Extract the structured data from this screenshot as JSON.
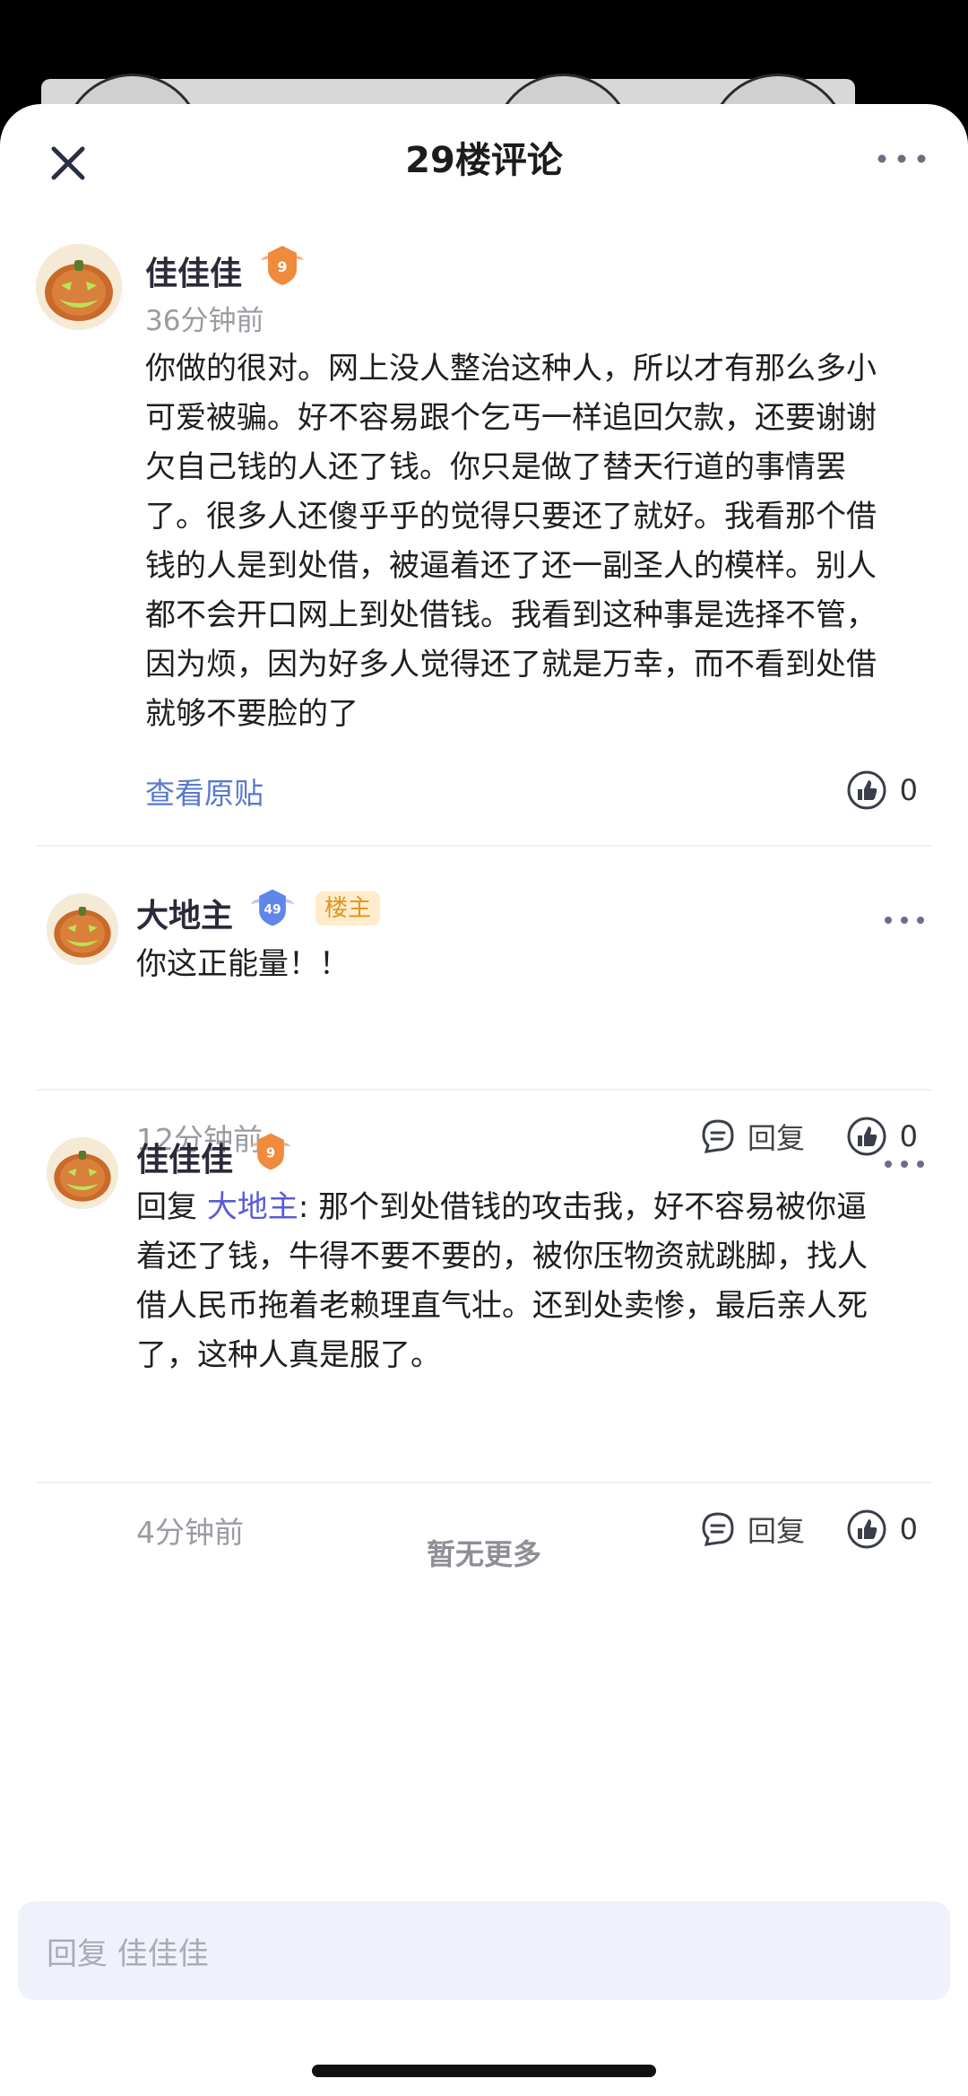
{
  "header": {
    "title": "29楼评论"
  },
  "comments": [
    {
      "author": "佳佳佳",
      "level": "9",
      "time": "36分钟前",
      "text_lines": [
        "你做的很对。网上没人整治这种人，所以才有那么多小",
        "可爱被骗。好不容易跟个乞丐一样追回欠款，还要谢谢",
        "欠自己钱的人还了钱。你只是做了替天行道的事情罢",
        "了。很多人还傻乎乎的觉得只要还了就好。我看那个借",
        "钱的人是到处借，被逼着还了还一副圣人的模样。别人",
        "都不会开口网上到处借钱。我看到这种事是选择不管，",
        "因为烦，因为好多人觉得还了就是万幸，而不看到处借",
        "就够不要脸的了"
      ],
      "view_original": "查看原贴",
      "likes": "0"
    },
    {
      "author": "大地主",
      "level": "49",
      "tag": "楼主",
      "text": "你这正能量！！",
      "time": "12分钟前",
      "reply_label": "回复",
      "likes": "0"
    },
    {
      "author": "佳佳佳",
      "level": "9",
      "reply_prefix": "回复",
      "mention": "大地主",
      "colon": ":",
      "text_line1": "那个到处借钱的攻击我，好不容易被你逼",
      "text_lines": [
        "着还了钱，牛得不要不要的，被你压物资就跳脚，找人",
        "借人民币拖着老赖理直气壮。还到处卖惨，最后亲人死",
        "了，这种人真是服了。"
      ],
      "time": "4分钟前",
      "reply_label": "回复",
      "likes": "0"
    }
  ],
  "end_text": "暂无更多",
  "input": {
    "placeholder": "回复 佳佳佳"
  },
  "colors": {
    "accent": "#5a79c9",
    "mention": "#5a5bd6",
    "host_tag_bg": "#ffeccc",
    "host_tag_fg": "#e0951e"
  }
}
